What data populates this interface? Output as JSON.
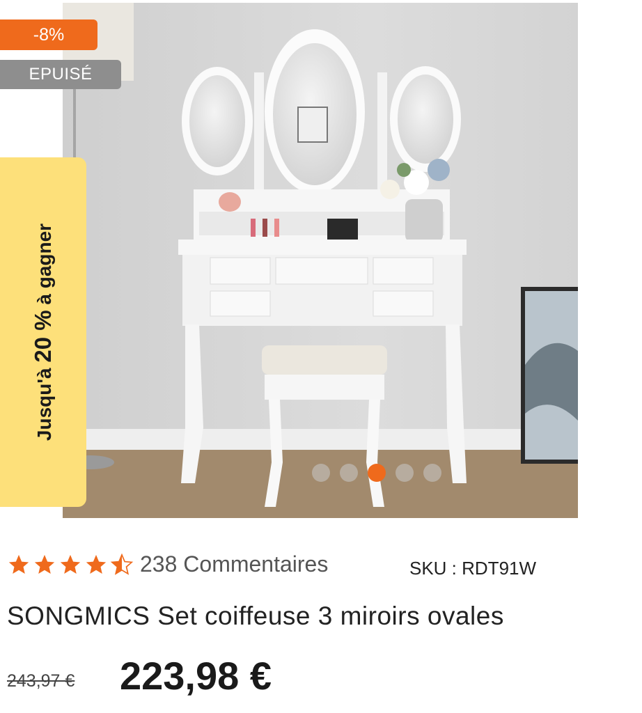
{
  "product": {
    "discount_badge": "-8%",
    "stock_badge": "EPUISÉ",
    "promo_prefix": "Jusqu'à ",
    "promo_value": "20 %",
    "promo_suffix": " à gagner",
    "image_alt": "Coiffeuse blanche avec trois miroirs ovales et tabouret",
    "gallery": {
      "slide_count": 5,
      "active_slide": 3
    },
    "rating": {
      "value": 4.5,
      "max": 5,
      "color": "#ef6a1c"
    },
    "reviews_label": "238 Commentaires",
    "sku_label": "SKU : RDT91W",
    "title": "SONGMICS Set coiffeuse 3 miroirs ovales",
    "price_old": "243,97 €",
    "price_new": "223,98 €"
  },
  "colors": {
    "accent": "#ef6a1c",
    "promo_bg": "#fde07a",
    "soldout_bg": "#8e8e8e"
  }
}
